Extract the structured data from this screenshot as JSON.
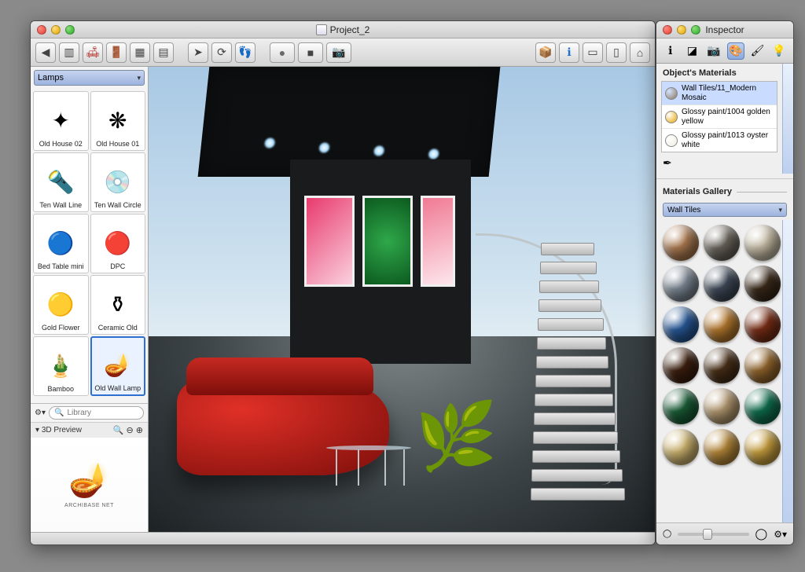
{
  "main_window": {
    "title": "Project_2",
    "toolbar": {
      "left_group": [
        "nav-back-icon",
        "column-icon",
        "sofa-icon",
        "door-icon",
        "window-icon",
        "layout-icon"
      ],
      "mid_group": [
        "pointer-icon",
        "rotate-icon",
        "walk-icon"
      ],
      "capture_group": [
        "record-icon",
        "stop-icon",
        "camera-icon"
      ],
      "right_group": [
        "package-icon",
        "info-icon",
        "view-2d-icon",
        "view-3d-icon",
        "home-icon"
      ]
    }
  },
  "library": {
    "category": "Lamps",
    "items": [
      {
        "label": "Old House 02",
        "icon": "chandelier"
      },
      {
        "label": "Old House 01",
        "icon": "chandelier2"
      },
      {
        "label": "Ten Wall Line",
        "icon": "spotlight"
      },
      {
        "label": "Ten Wall Circle",
        "icon": "spotlight2"
      },
      {
        "label": "Bed Table mini",
        "icon": "lamp-blue"
      },
      {
        "label": "DPC",
        "icon": "lamp-red"
      },
      {
        "label": "Gold Flower",
        "icon": "lamp-gold"
      },
      {
        "label": "Ceramic Old",
        "icon": "lamp-ceramic"
      },
      {
        "label": "Bamboo",
        "icon": "lamp-bamboo"
      },
      {
        "label": "Old Wall Lamp",
        "icon": "wall-lamp",
        "selected": true
      }
    ],
    "search_placeholder": "Library",
    "preview_label": "3D Preview",
    "preview_brand": "ARCHIBASE NET"
  },
  "inspector": {
    "title": "Inspector",
    "tabs": [
      "info-icon",
      "cube-icon",
      "camera-icon",
      "paint-icon",
      "brush-icon",
      "light-icon"
    ],
    "active_tab": 3,
    "materials_label": "Object's Materials",
    "materials": [
      {
        "name": "Wall Tiles/11_Modern Mosaic",
        "color": "#8a7860",
        "selected": true
      },
      {
        "name": "Glossy paint/1004 golden yellow",
        "color": "#e6a400"
      },
      {
        "name": "Glossy paint/1013 oyster white",
        "color": "#efece2"
      }
    ],
    "gallery_label": "Materials Gallery",
    "gallery_category": "Wall Tiles",
    "swatches": [
      "#ae7c52",
      "#6c675e",
      "#c8bda6",
      "#7e8996",
      "#404b5a",
      "#3b2a1a",
      "#285a9a",
      "#b77a2e",
      "#7a2e16",
      "#3e200f",
      "#4a3018",
      "#94672d",
      "#1a5e37",
      "#b59a70",
      "#0f6f4e",
      "#d0b670",
      "#b98a3a",
      "#caa13f"
    ],
    "slider_value": 0.35
  }
}
